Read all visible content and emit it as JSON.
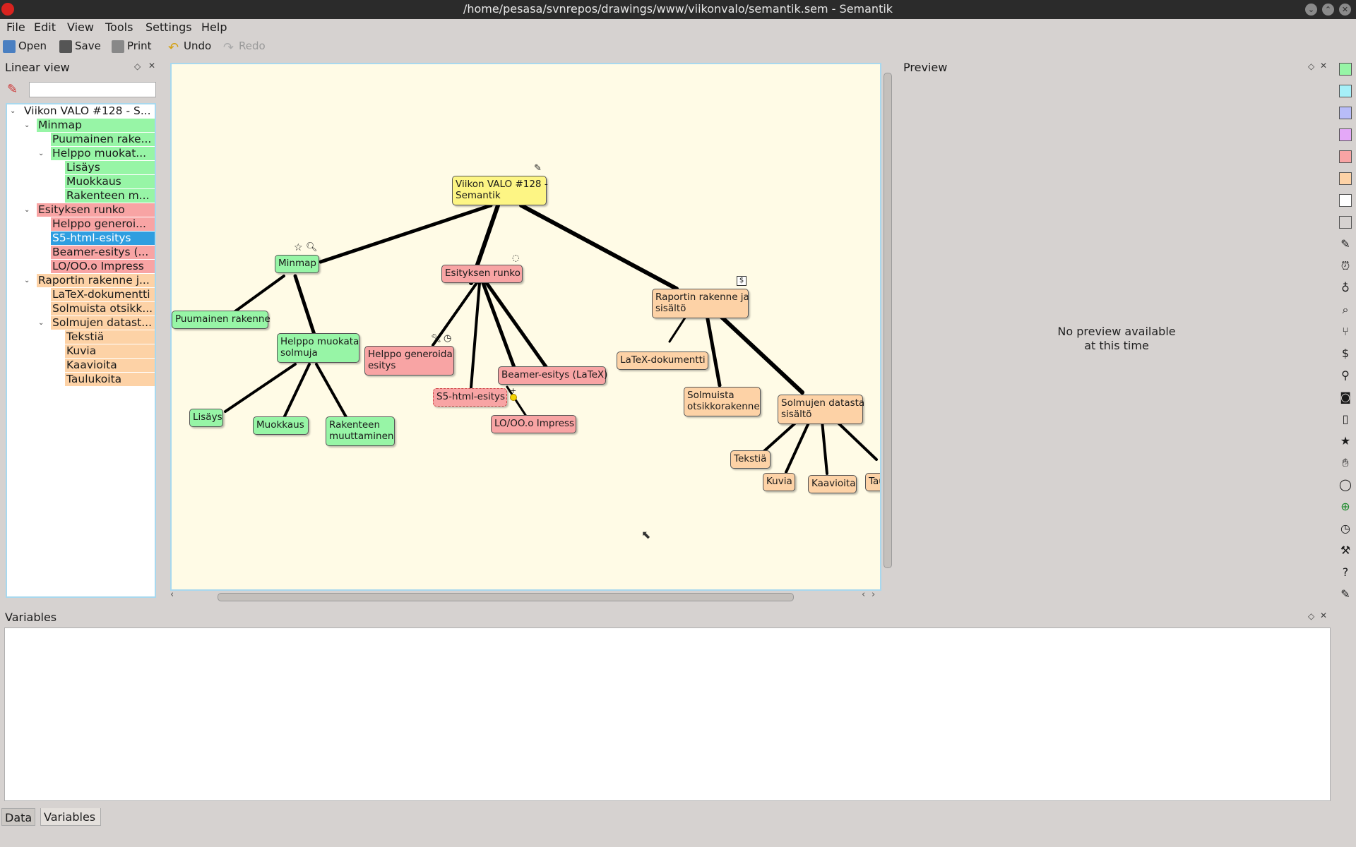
{
  "window": {
    "title": "/home/pesasa/svnrepos/drawings/www/viikonvalo/semantik.sem  - Semantik"
  },
  "menu": [
    "File",
    "Edit",
    "View",
    "Tools",
    "Settings",
    "Help"
  ],
  "toolbar": {
    "open": "Open",
    "save": "Save",
    "print": "Print",
    "undo": "Undo",
    "redo": "Redo"
  },
  "linear_view": {
    "title": "Linear view",
    "search_value": "",
    "items": [
      {
        "label": "Viikon VALO #128 - S...",
        "color": "white"
      },
      {
        "label": "Minmap",
        "color": "green"
      },
      {
        "label": "Puumainen rake...",
        "color": "green"
      },
      {
        "label": "Helppo muokat...",
        "color": "green"
      },
      {
        "label": "Lisäys",
        "color": "green"
      },
      {
        "label": "Muokkaus",
        "color": "green"
      },
      {
        "label": "Rakenteen m...",
        "color": "green"
      },
      {
        "label": "Esityksen runko",
        "color": "red"
      },
      {
        "label": "Helppo generoi...",
        "color": "red"
      },
      {
        "label": "S5-html-esitys",
        "color": "selected"
      },
      {
        "label": "Beamer-esitys (...",
        "color": "red"
      },
      {
        "label": "LO/OO.o Impress",
        "color": "red"
      },
      {
        "label": "Raportin rakenne j...",
        "color": "orange"
      },
      {
        "label": "LaTeX-dokumentti",
        "color": "orange"
      },
      {
        "label": "Solmuista otsikk...",
        "color": "orange"
      },
      {
        "label": "Solmujen datast...",
        "color": "orange"
      },
      {
        "label": "Tekstiä",
        "color": "orange"
      },
      {
        "label": "Kuvia",
        "color": "orange"
      },
      {
        "label": "Kaavioita",
        "color": "orange"
      },
      {
        "label": "Taulukoita",
        "color": "orange"
      }
    ]
  },
  "mindmap": {
    "root": {
      "line1": "Viikon VALO #128 -",
      "line2": "Semantik"
    },
    "minmap": "Minmap",
    "puumainen": "Puumainen rakenne",
    "helppo_muokata": {
      "line1": "Helppo muokata",
      "line2": "solmuja"
    },
    "lisays": "Lisäys",
    "muokkaus": "Muokkaus",
    "rakenteen": {
      "line1": "Rakenteen",
      "line2": "muuttaminen"
    },
    "esityksen": "Esityksen runko",
    "helppo_generoida": {
      "line1": "Helppo generoida",
      "line2": "esitys"
    },
    "s5": "S5-html-esitys",
    "beamer": "Beamer-esitys (LaTeX)",
    "impress": "LO/OO.o Impress",
    "raportin": {
      "line1": "Raportin rakenne ja",
      "line2": "sisältö"
    },
    "latex": "LaTeX-dokumentti",
    "solmuista": {
      "line1": "Solmuista",
      "line2": "otsikkorakenne"
    },
    "solmujen": {
      "line1": "Solmujen datasta",
      "line2": "sisältö"
    },
    "tekstia": "Tekstiä",
    "kuvia": "Kuvia",
    "kaavioita": "Kaavioita",
    "taulukoita": "Taulukoita"
  },
  "preview": {
    "title": "Preview",
    "line1": "No preview available",
    "line2": "at this time"
  },
  "variables": {
    "title": "Variables"
  },
  "bottom_tabs": [
    "Data",
    "Variables"
  ],
  "palette_colors": [
    "#97f5a6",
    "#a6f0f8",
    "#b8bcf8",
    "#e4a8f8",
    "#f8a4a4",
    "#fdd2a6",
    "#ffffff",
    "#d6d2d0"
  ]
}
